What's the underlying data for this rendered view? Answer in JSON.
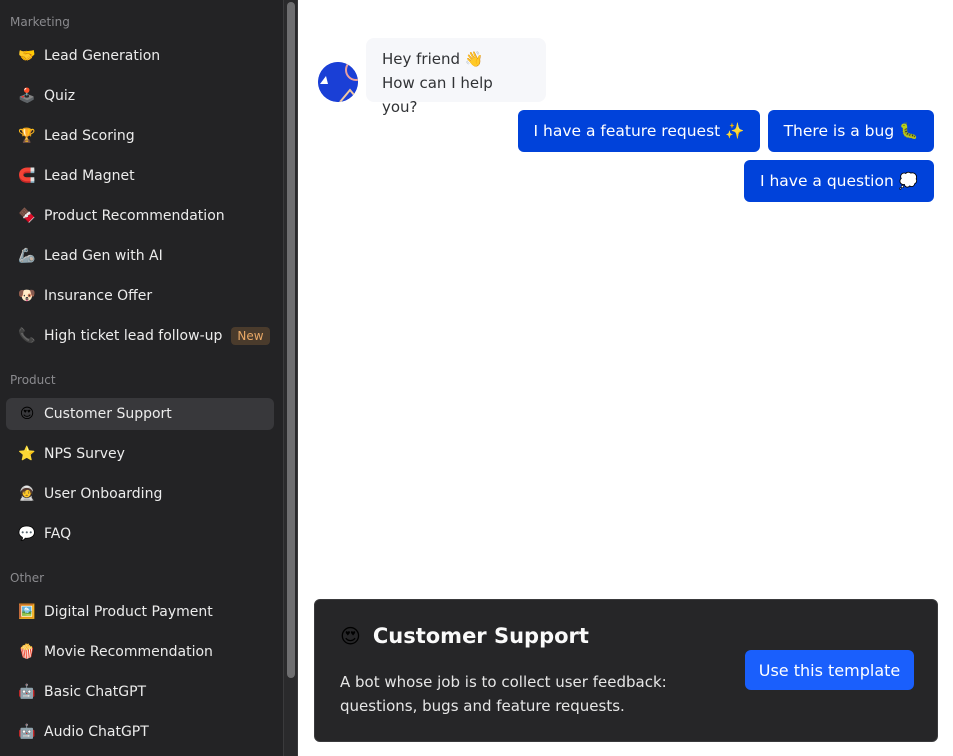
{
  "sidebar": {
    "sections": [
      {
        "label": "Marketing"
      },
      {
        "label": "Product"
      },
      {
        "label": "Other"
      }
    ],
    "items": [
      {
        "emoji": "🤝",
        "icon": "handshake-icon",
        "label": "Lead Generation"
      },
      {
        "emoji": "🕹️",
        "icon": "joystick-icon",
        "label": "Quiz"
      },
      {
        "emoji": "🏆",
        "icon": "trophy-icon",
        "label": "Lead Scoring"
      },
      {
        "emoji": "🧲",
        "icon": "magnet-icon",
        "label": "Lead Magnet"
      },
      {
        "emoji": "🍫",
        "icon": "chocolate-icon",
        "label": "Product Recommendation"
      },
      {
        "emoji": "🦾",
        "icon": "mechanical-arm-icon",
        "label": "Lead Gen with AI"
      },
      {
        "emoji": "🐶",
        "icon": "dog-icon",
        "label": "Insurance Offer"
      },
      {
        "emoji": "📞",
        "icon": "phone-icon",
        "label": "High ticket lead follow-up",
        "badge": "New"
      },
      {
        "emoji": "😍",
        "icon": "heart-eyes-icon",
        "label": "Customer Support",
        "active": true
      },
      {
        "emoji": "⭐",
        "icon": "star-icon",
        "label": "NPS Survey"
      },
      {
        "emoji": "🧑‍🚀",
        "icon": "astronaut-icon",
        "label": "User Onboarding"
      },
      {
        "emoji": "💬",
        "icon": "speech-bubble-icon",
        "label": "FAQ"
      },
      {
        "emoji": "🖼️",
        "icon": "picture-icon",
        "label": "Digital Product Payment"
      },
      {
        "emoji": "🍿",
        "icon": "popcorn-icon",
        "label": "Movie Recommendation"
      },
      {
        "emoji": "🤖",
        "icon": "robot-icon",
        "label": "Basic ChatGPT"
      },
      {
        "emoji": "🤖",
        "icon": "robot-icon",
        "label": "Audio ChatGPT"
      }
    ]
  },
  "chat": {
    "bot_message": {
      "line1": "Hey friend 👋",
      "line2": "How can I help you?"
    },
    "choices": [
      {
        "label": "I have a feature request ✨"
      },
      {
        "label": "There is a bug 🐛"
      },
      {
        "label": "I have a question 💭"
      }
    ]
  },
  "template_card": {
    "emoji": "😍",
    "title": "Customer Support",
    "description": "A bot whose job is to collect user feedback: questions, bugs and feature requests.",
    "button_label": "Use this template"
  },
  "colors": {
    "accent": "#0042da",
    "cta": "#1a5ffc",
    "sidebar_bg": "#232325",
    "badge_text": "#e8a866"
  }
}
